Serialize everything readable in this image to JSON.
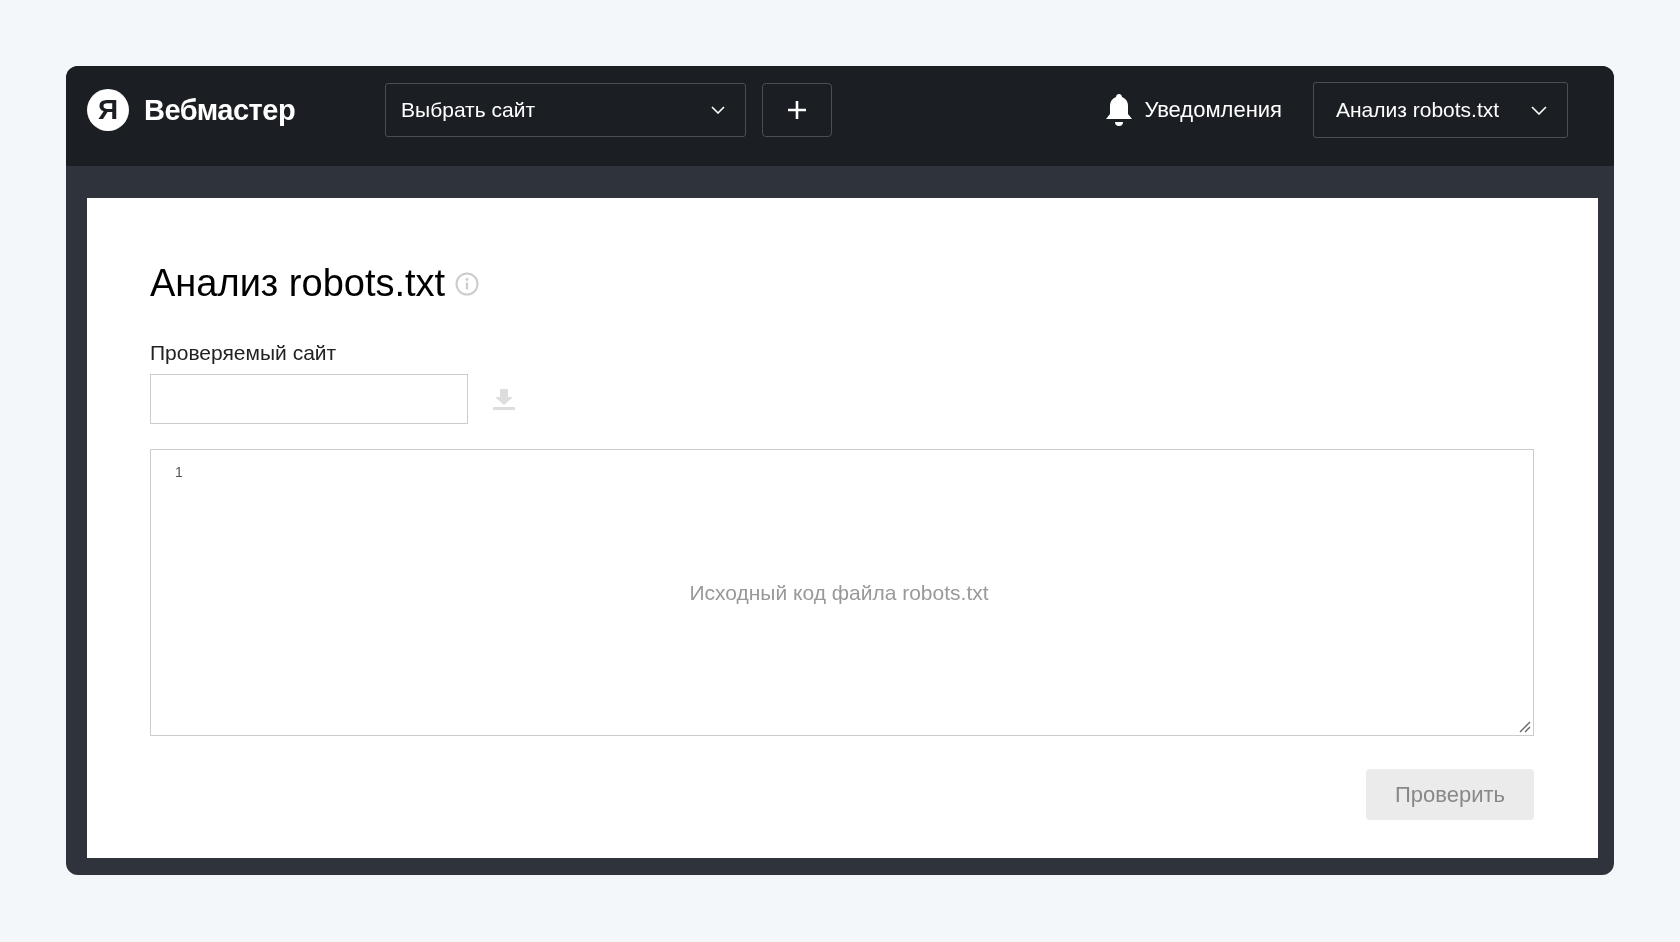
{
  "header": {
    "logo_letter": "Я",
    "brand": "Вебмастер",
    "site_select": {
      "value": "Выбрать сайт"
    },
    "notifications": "Уведомления",
    "tool_menu": "Анализ robots.txt"
  },
  "page": {
    "title": "Анализ robots.txt",
    "site_field": {
      "label": "Проверяемый сайт"
    },
    "editor": {
      "line_numbers": [
        "1"
      ],
      "placeholder": "Исходный код файла robots.txt"
    },
    "check_button": {
      "label": "Проверить",
      "disabled": true
    }
  }
}
